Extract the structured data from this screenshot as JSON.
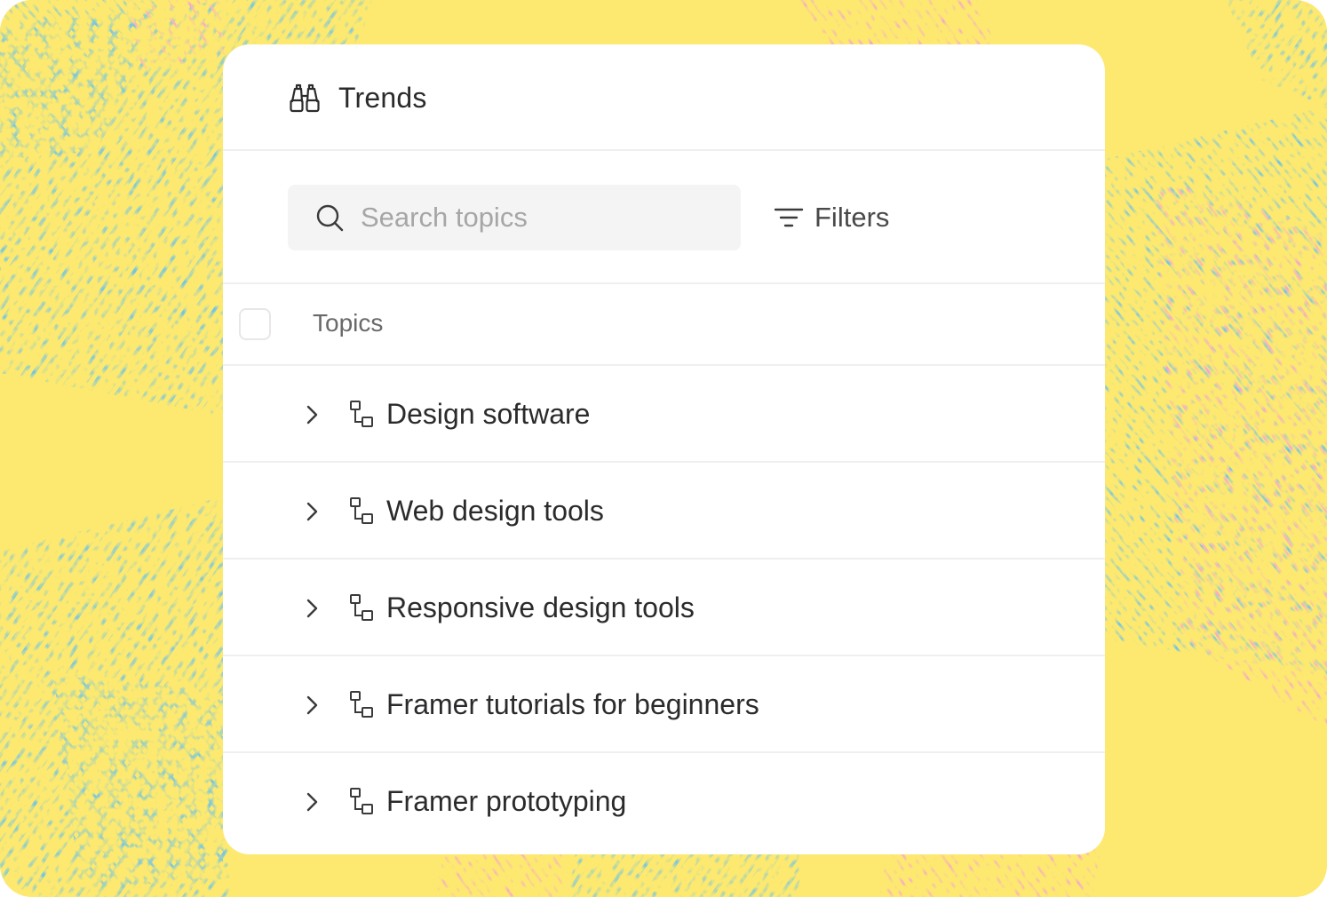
{
  "colors": {
    "background": "#fde96f",
    "texture_blue": "#6cc3e8",
    "texture_pink": "#f6a3d4",
    "card": "#ffffff",
    "divider": "#f1eeee",
    "text": "#2b2b2d",
    "placeholder": "#a7a5a5"
  },
  "header": {
    "icon": "binoculars-icon",
    "title": "Trends"
  },
  "toolbar": {
    "search": {
      "icon": "search-icon",
      "placeholder": "Search topics",
      "value": ""
    },
    "filters": {
      "icon": "filters-icon",
      "label": "Filters"
    }
  },
  "list": {
    "column_header": "Topics",
    "select_all_checked": false,
    "rows": [
      {
        "label": "Design software",
        "icon": "topic-hierarchy-icon",
        "expand_icon": "chevron-right-icon"
      },
      {
        "label": "Web design tools",
        "icon": "topic-hierarchy-icon",
        "expand_icon": "chevron-right-icon"
      },
      {
        "label": "Responsive design tools",
        "icon": "topic-hierarchy-icon",
        "expand_icon": "chevron-right-icon"
      },
      {
        "label": "Framer tutorials for beginners",
        "icon": "topic-hierarchy-icon",
        "expand_icon": "chevron-right-icon"
      },
      {
        "label": "Framer prototyping",
        "icon": "topic-hierarchy-icon",
        "expand_icon": "chevron-right-icon"
      }
    ]
  }
}
